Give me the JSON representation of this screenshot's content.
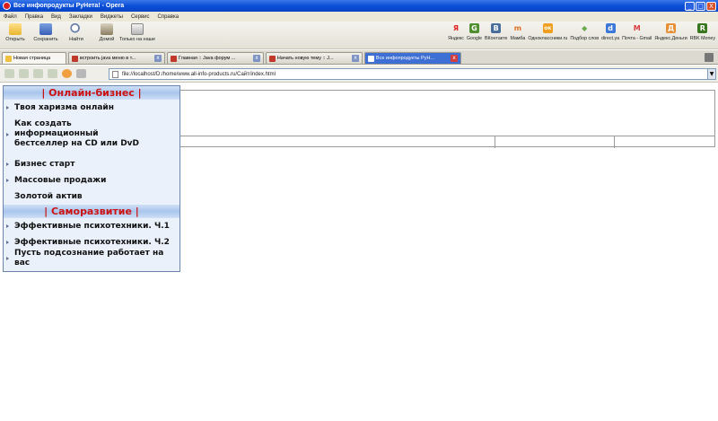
{
  "window": {
    "title": "Все инфопродукты РуНета! - Opera",
    "buttons": [
      "_",
      "□",
      "X"
    ]
  },
  "menu": [
    "Файл",
    "Правка",
    "Вид",
    "Закладки",
    "Виджеты",
    "Сервис",
    "Справка"
  ],
  "toolbar": {
    "open": "Открыть",
    "save": "Сохранить",
    "find": "Найти",
    "home": "Домой",
    "tome": "Только на наше"
  },
  "bookmarks": [
    {
      "label": "Яндекс",
      "glyph": "Я",
      "color": "#e02020"
    },
    {
      "label": "Google",
      "glyph": "G",
      "color": "#4f8f2f"
    },
    {
      "label": "ВКонтакте",
      "glyph": "B",
      "color": "#4a6d9c"
    },
    {
      "label": "Мамба",
      "glyph": "m",
      "color": "#e07020"
    },
    {
      "label": "Одноклассники.ru",
      "glyph": "ок",
      "color": "#f0a020"
    },
    {
      "label": "Подбор слов",
      "glyph": "◆",
      "color": "#6aa84f"
    },
    {
      "label": "direct.ya",
      "glyph": "d",
      "color": "#3c78d8"
    },
    {
      "label": "Почта - Gmail",
      "glyph": "M",
      "color": "#d83b3b"
    },
    {
      "label": "Яндекс.Деньги",
      "glyph": "Д",
      "color": "#e69138"
    },
    {
      "label": "RBK Money",
      "glyph": "R",
      "color": "#38761d"
    }
  ],
  "tabs": [
    {
      "label": "Новая страница",
      "active": false,
      "type": "newpage"
    },
    {
      "label": "встроить java меню в т...",
      "active": false,
      "type": "normal"
    },
    {
      "label": "Главная :: Java форум ...",
      "active": false,
      "type": "normal"
    },
    {
      "label": "Начать новую тему :: J...",
      "active": false,
      "type": "normal"
    },
    {
      "label": "Все инфопродукты РуН...",
      "active": true,
      "type": "active"
    }
  ],
  "address": {
    "url": "file://localhost/D:/home/www.all-info-products.ru/Сайт/index.html"
  },
  "sidemenu": {
    "sections": [
      {
        "title": "| Онлайн-бизнес |",
        "items": [
          {
            "label": "Твоя харизма онлайн",
            "lines": 1,
            "arrow": true
          },
          {
            "label": "Как создать информационный бестселлер на CD или DvD",
            "lines": 3,
            "arrow": true
          },
          {
            "label": "Бизнес старт",
            "lines": 1,
            "arrow": true
          },
          {
            "label": "Массовые продажи",
            "lines": 1,
            "arrow": true
          },
          {
            "label": "Золотой актив",
            "lines": 1,
            "arrow": false
          }
        ]
      },
      {
        "title": "| Саморазвитие |",
        "items": [
          {
            "label": "Эффективные психотехники. Ч.1",
            "lines": 1,
            "arrow": true
          },
          {
            "label": "Эффективные психотехники. Ч.2",
            "lines": 1,
            "arrow": true
          },
          {
            "label": "Пусть подсознание работает на вас",
            "lines": 1,
            "arrow": true
          }
        ]
      }
    ]
  }
}
